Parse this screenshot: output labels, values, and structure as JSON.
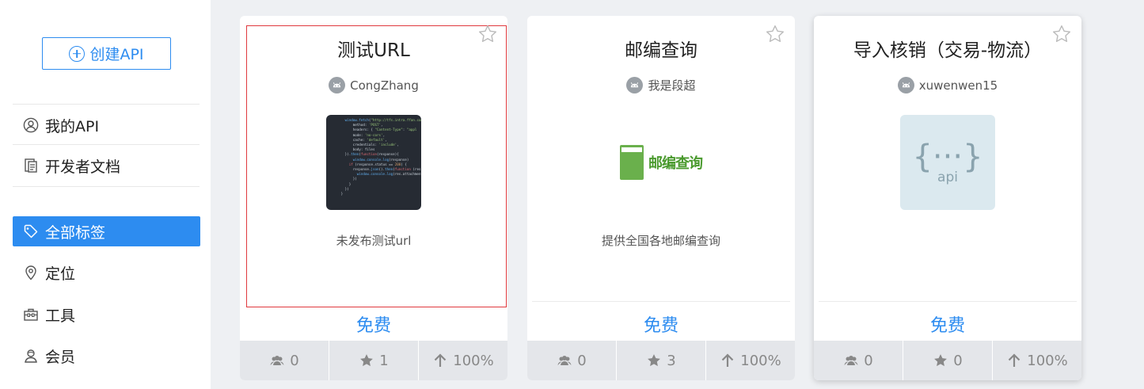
{
  "sidebar": {
    "create_label": "创建API",
    "items": [
      {
        "label": "我的API",
        "icon": "user-icon"
      },
      {
        "label": "开发者文档",
        "icon": "document-icon"
      },
      {
        "label": "全部标签",
        "icon": "tag-icon",
        "active": true
      },
      {
        "label": "定位",
        "icon": "location-pin-icon"
      },
      {
        "label": "工具",
        "icon": "toolbox-icon"
      },
      {
        "label": "会员",
        "icon": "member-icon"
      }
    ]
  },
  "cards": [
    {
      "title": "测试URL",
      "author": "CongZhang",
      "description": "未发布测试url",
      "price": "免费",
      "thumbnail": "code-screenshot",
      "stats": {
        "users": "0",
        "stars": "1",
        "rate": "100%"
      }
    },
    {
      "title": "邮编查询",
      "author": "我是段超",
      "description": "提供全国各地邮编查询",
      "price": "免费",
      "thumbnail": "postal-logo",
      "thumbnail_text": "邮编查询",
      "stats": {
        "users": "0",
        "stars": "3",
        "rate": "100%"
      }
    },
    {
      "title": "导入核销（交易-物流）",
      "author": "xuwenwen15",
      "description": "",
      "price": "免费",
      "thumbnail": "api-placeholder",
      "thumbnail_text": "api",
      "stats": {
        "users": "0",
        "stars": "0",
        "rate": "100%"
      }
    }
  ],
  "colors": {
    "accent": "#2d8cf0",
    "background": "#eef0f3",
    "stats_bar": "#e4e6ea"
  }
}
